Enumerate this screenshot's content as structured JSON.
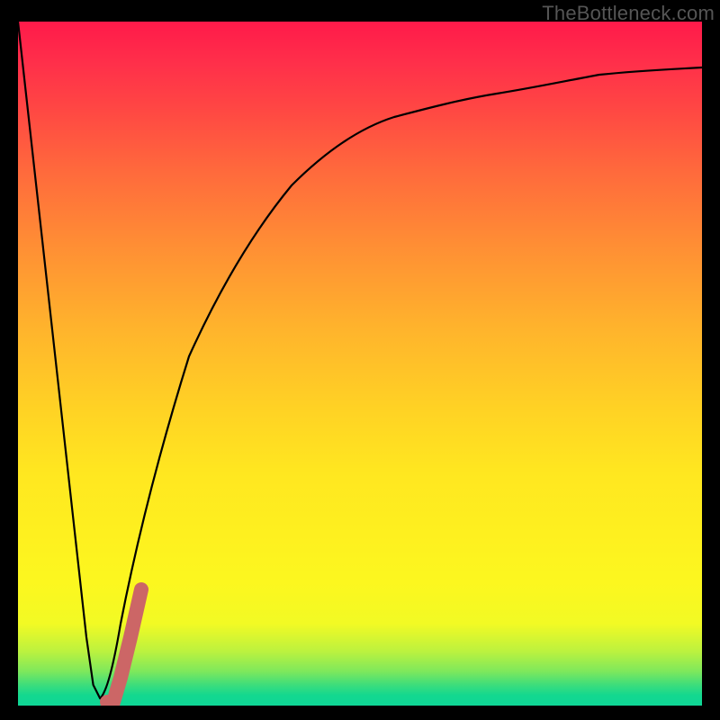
{
  "watermark": {
    "text": "TheBottleneck.com"
  },
  "chart_data": {
    "type": "line",
    "title": "",
    "xlabel": "",
    "ylabel": "",
    "xlim": [
      0,
      100
    ],
    "ylim": [
      0,
      100
    ],
    "grid": false,
    "legend": false,
    "series": [
      {
        "name": "bottleneck-curve",
        "color": "#000000",
        "x": [
          0,
          5,
          10,
          11,
          12,
          13,
          14,
          15,
          17,
          20,
          25,
          30,
          35,
          40,
          45,
          50,
          55,
          60,
          65,
          70,
          75,
          80,
          85,
          90,
          95,
          100
        ],
        "values": [
          100,
          55,
          10,
          3,
          1,
          2,
          6,
          12,
          22,
          35,
          51,
          62,
          70,
          76,
          80,
          84,
          86,
          88,
          89.5,
          90.6,
          91.5,
          92.2,
          92.7,
          93,
          93.2,
          93.3
        ]
      },
      {
        "name": "pink-segment",
        "color": "#cc6666",
        "x": [
          13,
          14,
          15,
          16.5,
          18
        ],
        "values": [
          0.5,
          0.5,
          4,
          10,
          17
        ]
      }
    ],
    "gradient_background": {
      "top": "#ff1a4a",
      "mid": "#ffd324",
      "bottom": "#0fd696"
    }
  }
}
